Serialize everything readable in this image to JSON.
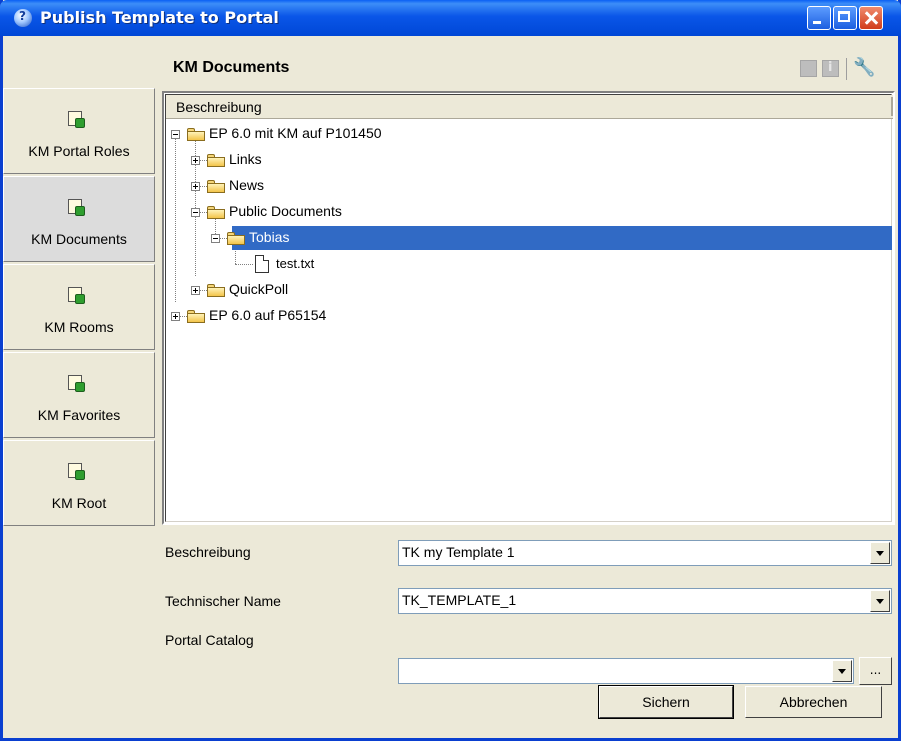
{
  "window": {
    "title": "Publish Template to Portal"
  },
  "header": {
    "title": "KM Documents",
    "icons": [
      "disabled-square-icon",
      "info-icon",
      "tools-icon"
    ]
  },
  "sidebar": {
    "items": [
      {
        "label": "KM Portal Roles",
        "icon": "portal-page-icon",
        "active": false
      },
      {
        "label": "KM Documents",
        "icon": "portal-page-icon",
        "active": true
      },
      {
        "label": "KM Rooms",
        "icon": "portal-page-icon",
        "active": false
      },
      {
        "label": "KM Favorites",
        "icon": "portal-page-icon",
        "active": false
      },
      {
        "label": "KM Root",
        "icon": "portal-page-icon",
        "active": false
      }
    ]
  },
  "tree": {
    "column_header": "Beschreibung",
    "nodes": [
      {
        "label": "EP 6.0 mit KM auf P101450",
        "level": 0,
        "expanded": true,
        "type": "folder"
      },
      {
        "label": "Links",
        "level": 1,
        "expanded": false,
        "type": "folder"
      },
      {
        "label": "News",
        "level": 1,
        "expanded": false,
        "type": "folder"
      },
      {
        "label": "Public Documents",
        "level": 1,
        "expanded": true,
        "type": "folder"
      },
      {
        "label": "Tobias",
        "level": 2,
        "expanded": true,
        "type": "folder",
        "selected": true
      },
      {
        "label": "test.txt",
        "level": 3,
        "type": "file"
      },
      {
        "label": "QuickPoll",
        "level": 1,
        "expanded": false,
        "type": "folder"
      },
      {
        "label": "EP 6.0 auf P65154",
        "level": 0,
        "expanded": false,
        "type": "folder"
      }
    ]
  },
  "form": {
    "beschreibung_label": "Beschreibung",
    "beschreibung_value": "TK my Template 1",
    "technischer_name_label": "Technischer Name",
    "technischer_name_value": "TK_TEMPLATE_1",
    "portal_catalog_label": "Portal Catalog",
    "portal_catalog_value": "",
    "ellipsis_label": "..."
  },
  "buttons": {
    "save": "Sichern",
    "cancel": "Abbrechen"
  },
  "colors": {
    "titlebar": "#0a56e8",
    "selection": "#316ac5",
    "window_bg": "#ece9d8"
  }
}
